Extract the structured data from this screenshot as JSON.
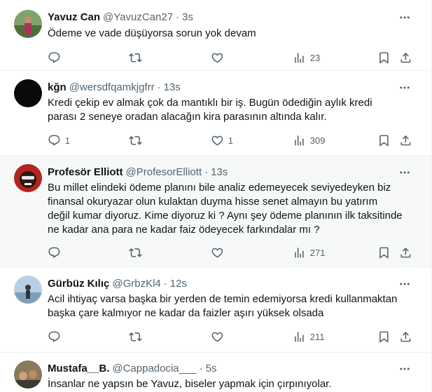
{
  "colors": {
    "text": "#0f1419",
    "secondary": "#536471",
    "border": "#eff3f4",
    "highlight_bg": "#f7f9f9"
  },
  "tweets": [
    {
      "name": "Yavuz Can",
      "handle": "@YavuzCan27",
      "dot": "·",
      "time": "3s",
      "lines": [
        "Ödeme ve vade düşüyorsa sorun yok devam"
      ],
      "replies": "",
      "retweets": "",
      "likes": "",
      "views": "23"
    },
    {
      "name": "kğn",
      "handle": "@wersdfqamkjgfrr",
      "dot": "·",
      "time": "13s",
      "lines": [
        "Kredi çekip ev almak çok da mantıklı bir iş. Bugün ödediğin aylık kredi",
        "parası 2 seneye oradan alacağın kira parasının altında kalır."
      ],
      "replies": "1",
      "retweets": "",
      "likes": "1",
      "views": "309"
    },
    {
      "name": "Profesör Elliott",
      "handle": "@ProfesorElliott",
      "dot": "·",
      "time": "13s",
      "lines": [
        "Bu millet elindeki ödeme planını bile analiz edemeyecek seviyedeyken biz",
        "finansal okuryazar olun kulaktan duyma hisse senet almayın bu yatırım",
        "değil kumar diyoruz. Kime diyoruz ki ? Aynı şey ödeme planının ilk taksitinde",
        "ne kadar ana para ne kadar faiz ödeyecek farkındalar mı ?"
      ],
      "replies": "",
      "retweets": "",
      "likes": "",
      "views": "271"
    },
    {
      "name": "Gürbüz Kılıç",
      "handle": "@GrbzKl4",
      "dot": "·",
      "time": "12s",
      "lines": [
        "Acil ihtiyaç varsa başka bir yerden de temin edemiyorsa kredi kullanmaktan",
        "başka çare kalmıyor ne kadar da faizler aşırı yüksek olsada"
      ],
      "replies": "",
      "retweets": "",
      "likes": "",
      "views": "211"
    },
    {
      "name": "Mustafa__B.",
      "handle": "@Cappadocia___",
      "dot": "·",
      "time": "5s",
      "lines": [
        "İnsanlar ne yapsın be Yavuz, biseler yapmak için çırpınıyolar."
      ]
    }
  ]
}
